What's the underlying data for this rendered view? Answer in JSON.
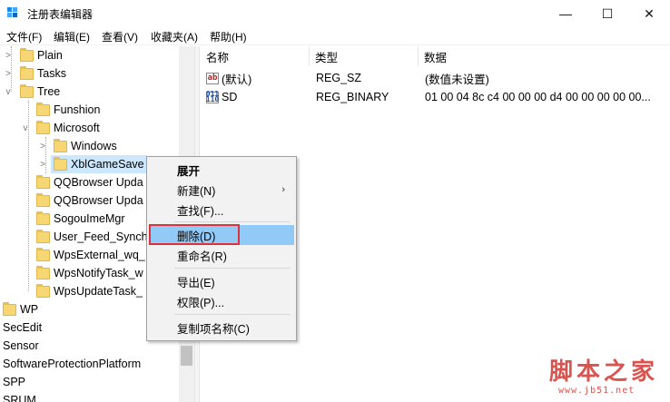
{
  "window": {
    "title": "注册表编辑器",
    "min_label": "—",
    "max_label": "☐",
    "close_label": "✕"
  },
  "menu": [
    "文件(F)",
    "编辑(E)",
    "查看(V)",
    "收藏夹(A)",
    "帮助(H)"
  ],
  "tree": {
    "items": [
      {
        "label": "Plain"
      },
      {
        "label": "Tasks"
      },
      {
        "label": "Tree"
      },
      {
        "label": "Funshion"
      },
      {
        "label": "Microsoft"
      },
      {
        "label": "Windows"
      },
      {
        "label": "XblGameSave"
      },
      {
        "label": "QQBrowser Upda"
      },
      {
        "label": "QQBrowser Upda"
      },
      {
        "label": "SogouImeMgr"
      },
      {
        "label": "User_Feed_Synch"
      },
      {
        "label": "WpsExternal_wq_"
      },
      {
        "label": "WpsNotifyTask_w"
      },
      {
        "label": "WpsUpdateTask_"
      },
      {
        "label": "WP"
      },
      {
        "label": "SecEdit"
      },
      {
        "label": "Sensor"
      },
      {
        "label": "SoftwareProtectionPlatform"
      },
      {
        "label": "SPP"
      },
      {
        "label": "SRUM"
      }
    ]
  },
  "list": {
    "columns": [
      "名称",
      "类型",
      "数据"
    ],
    "rows": [
      {
        "icon": "string-value-icon",
        "name": "(默认)",
        "type": "REG_SZ",
        "data": "(数值未设置)"
      },
      {
        "icon": "binary-value-icon",
        "name": "SD",
        "type": "REG_BINARY",
        "data": "01 00 04 8c c4 00 00 00 d4 00 00 00 00 00..."
      }
    ]
  },
  "context_menu": {
    "items": [
      {
        "label": "展开"
      },
      {
        "label": "新建(N)"
      },
      {
        "label": "查找(F)..."
      },
      {
        "label": "删除(D)"
      },
      {
        "label": "重命名(R)"
      },
      {
        "label": "导出(E)"
      },
      {
        "label": "权限(P)..."
      },
      {
        "label": "复制项名称(C)"
      }
    ],
    "submenu_arrow": "›"
  },
  "watermark": {
    "main": "脚本之家",
    "url": "www.jb51.net"
  },
  "colors": {
    "highlight": "#91c9f7",
    "redbox": "#e0303a",
    "folder": "#f7d774",
    "watermark": "#d9534f"
  }
}
